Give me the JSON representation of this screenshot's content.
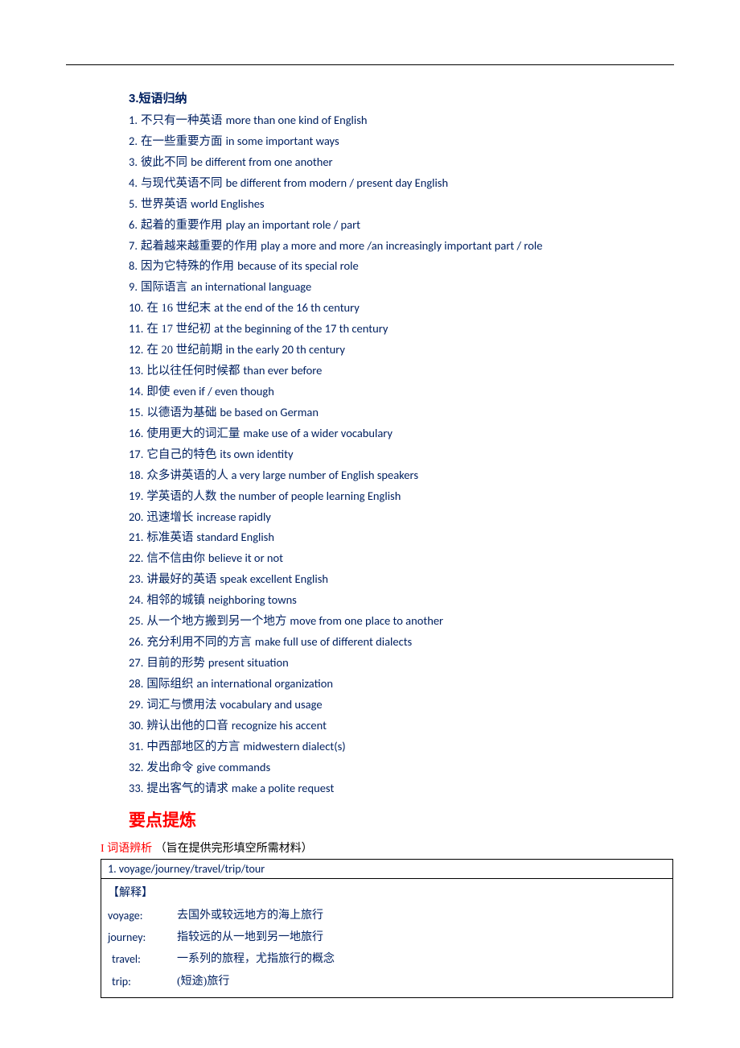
{
  "sections": {
    "phrases": {
      "header": "3.短语归纳",
      "items": [
        {
          "num": "1.",
          "cn": "不只有一种英语",
          "en": "more than one kind of English"
        },
        {
          "num": "2.",
          "cn": "在一些重要方面",
          "en": "in some important ways"
        },
        {
          "num": "3.",
          "cn": "彼此不同",
          "en": "be different from one another"
        },
        {
          "num": "4.",
          "cn": "与现代英语不同",
          "en": "be different from modern / present day English"
        },
        {
          "num": "5.",
          "cn": "世界英语",
          "en": "world Englishes"
        },
        {
          "num": "6.",
          "cn": "起着的重要作用",
          "en": "play an important role / part"
        },
        {
          "num": "7.",
          "cn": "起着越来越重要的作用",
          "en": "play a more and more /an increasingly important part / role"
        },
        {
          "num": "8.",
          "cn": "因为它特殊的作用",
          "en": "because of its special role"
        },
        {
          "num": "9.",
          "cn": "国际语言",
          "en": "an international language"
        },
        {
          "num": "10.",
          "cn": "在 16 世纪末",
          "en": "at the end of the 16 th century"
        },
        {
          "num": "11.",
          "cn": "在 17 世纪初",
          "en": "at the beginning of the 17 th century"
        },
        {
          "num": "12.",
          "cn": "在 20 世纪前期",
          "en": "in the early 20 th century"
        },
        {
          "num": "13.",
          "cn": "比以往任何时候都",
          "en": "than ever before"
        },
        {
          "num": "14.",
          "cn": "即使",
          "en": "even if / even though"
        },
        {
          "num": "15.",
          "cn": "以德语为基础",
          "en": "be based on German"
        },
        {
          "num": "16.",
          "cn": "使用更大的词汇量",
          "en": "make use of a wider vocabulary"
        },
        {
          "num": "17.",
          "cn": "它自己的特色",
          "en": "its own identity"
        },
        {
          "num": "18.",
          "cn": "众多讲英语的人  ",
          "en": "a very large number of English speakers"
        },
        {
          "num": "19.",
          "cn": "学英语的人数",
          "en": "the number of people learning English"
        },
        {
          "num": "20.",
          "cn": "迅速增长",
          "en": "increase rapidly"
        },
        {
          "num": "21.",
          "cn": "标准英语",
          "en": "standard English"
        },
        {
          "num": "22.",
          "cn": "信不信由你",
          "en": "believe it or not"
        },
        {
          "num": "23.",
          "cn": "讲最好的英语",
          "en": "speak excellent English"
        },
        {
          "num": "24.",
          "cn": "相邻的城镇",
          "en": "neighboring towns"
        },
        {
          "num": "25.",
          "cn": "从一个地方搬到另一个地方",
          "en": "move from one place to another"
        },
        {
          "num": "26.",
          "cn": "充分利用不同的方言",
          "en": "make full use of different dialects"
        },
        {
          "num": "27.",
          "cn": "目前的形势",
          "en": "present situation"
        },
        {
          "num": "28.",
          "cn": "国际组织",
          "en": "an international organization"
        },
        {
          "num": "29.",
          "cn": "词汇与惯用法",
          "en": "vocabulary and usage"
        },
        {
          "num": "30.",
          "cn": "辨认出他的口音",
          "en": "recognize his accent"
        },
        {
          "num": "31.",
          "cn": "中西部地区的方言",
          "en": "midwestern dialect(s)"
        },
        {
          "num": "32.",
          "cn": "发出命令",
          "en": "give commands"
        },
        {
          "num": "33.",
          "cn": "提出客气的请求",
          "en": "make a polite request"
        }
      ]
    },
    "keypoints": {
      "header": "要点提炼",
      "sub_label": "I 词语辨析",
      "sub_note": "  （旨在提供完形填空所需材料）",
      "box": {
        "title": "1. voyage/journey/travel/trip/tour",
        "explain_label": "【解释】",
        "defs": [
          {
            "term": "voyage:",
            "desc": "去国外或较远地方的海上旅行"
          },
          {
            "term": "journey:",
            "desc": "指较远的从一地到另一地旅行"
          },
          {
            "term": "travel:",
            "desc": "一系列的旅程，尤指旅行的概念"
          },
          {
            "term": "trip:",
            "desc": "(短途)旅行"
          }
        ]
      }
    }
  }
}
